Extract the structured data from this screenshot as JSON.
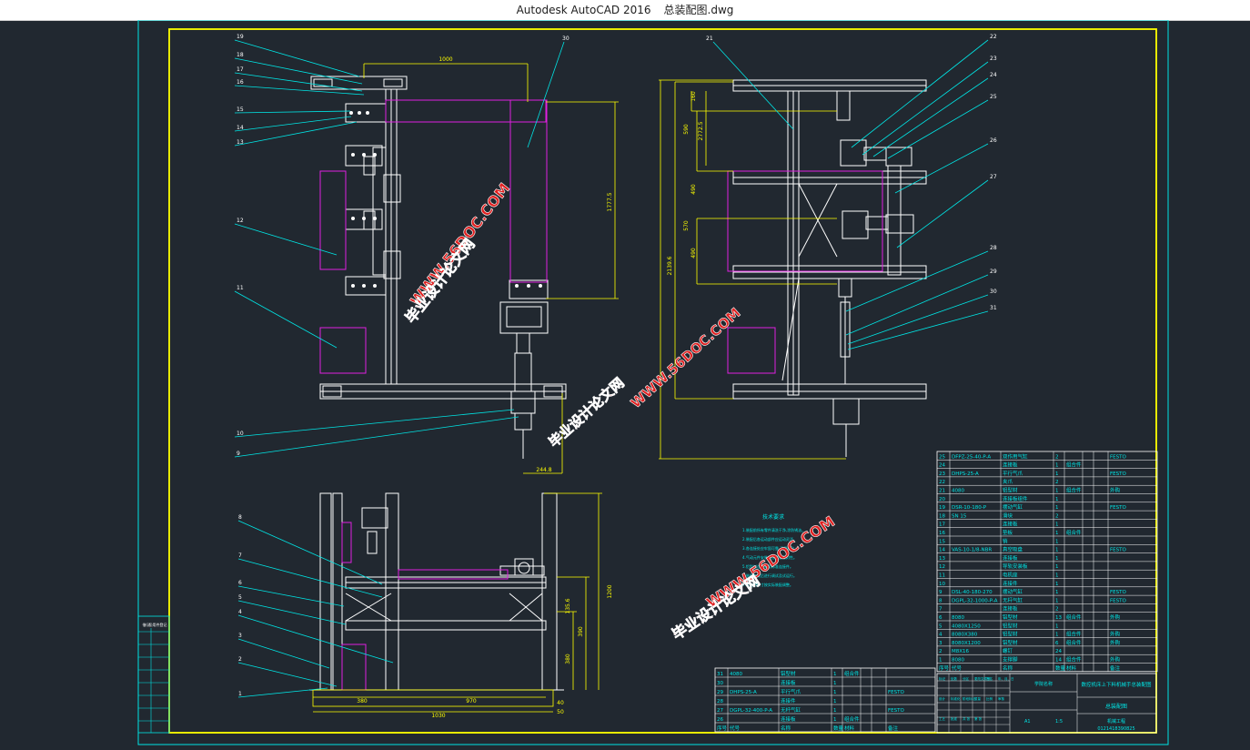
{
  "window": {
    "app_title": "Autodesk AutoCAD 2016",
    "file_name": "总装配图.dwg"
  },
  "colors": {
    "background": "#212830",
    "frame": "#ffff00",
    "leader": "#00e5e5",
    "part": "#ffffff",
    "outline": "#e020e0",
    "watermark": "#e02020"
  },
  "watermarks": [
    {
      "text": "WWW.56DOC.COM"
    },
    {
      "text": "毕业设计论文网"
    },
    {
      "text": "WWW.56DOC.COM"
    },
    {
      "text": "毕业设计论文网"
    },
    {
      "text": "WWW.56DOC.COM"
    },
    {
      "text": "毕业设计论文网"
    }
  ],
  "balloons": {
    "front_left": [
      "19",
      "18",
      "17",
      "16",
      "15",
      "14",
      "13",
      "12",
      "11",
      "10",
      "9"
    ],
    "top_center": "30",
    "side_right_top": "21",
    "side_right": [
      "22",
      "23",
      "24",
      "25",
      "26",
      "27",
      "28",
      "29",
      "30",
      "31"
    ],
    "bottom_left": [
      "8",
      "7",
      "6",
      "5",
      "4",
      "3",
      "2",
      "1"
    ]
  },
  "dimensions": {
    "front_width": "1000",
    "front_height": "1777.5",
    "front_bottom": "244.8",
    "side_total": "2139.6",
    "side_a": "160",
    "side_b": "590",
    "side_c": "2772.5",
    "side_d": "490",
    "side_e": "570",
    "side_f": "490",
    "bottom_a": "380",
    "bottom_b": "970",
    "bottom_c": "1030",
    "bottom_d": "135.6",
    "bottom_e": "390",
    "bottom_f": "380",
    "bottom_g": "1200",
    "bottom_h": "40",
    "bottom_i": "50"
  },
  "notes": {
    "title": "技术要求",
    "lines": [
      "1.装配前所有零件清洗干净,涂防锈油。",
      "2.装配后各运动部件应运动灵活。",
      "3.各连接处应牢固可靠,不得松动。",
      "4.气动元件安装前应检查密封性。",
      "5.铝型材连接采用标准连接件。",
      "6.装配完成后进行调试及试运行。",
      "7.未注明尺寸按实际装配调整。"
    ]
  },
  "left_stamp": {
    "header": "借(通)用件登记",
    "rows": [
      "",
      "",
      "",
      "",
      "",
      "",
      "",
      ""
    ]
  },
  "bom_upper": {
    "rows": [
      {
        "no": "25",
        "code": "DFPZ-25-40-P-A",
        "name": "双作用气缸",
        "qty": "2",
        "mat": "",
        "note": "FESTO"
      },
      {
        "no": "24",
        "code": "",
        "name": "连接板",
        "qty": "1",
        "mat": "组合件",
        "note": ""
      },
      {
        "no": "23",
        "code": "DHPS-25-A",
        "name": "平行气爪",
        "qty": "1",
        "mat": "",
        "note": "FESTO"
      },
      {
        "no": "22",
        "code": "",
        "name": "夹爪",
        "qty": "2",
        "mat": "",
        "note": ""
      },
      {
        "no": "21",
        "code": "4080",
        "name": "铝型材",
        "qty": "1",
        "mat": "组合件",
        "note": "外购"
      },
      {
        "no": "20",
        "code": "",
        "name": "连接板组件",
        "qty": "1",
        "mat": "",
        "note": ""
      },
      {
        "no": "19",
        "code": "DSR-10-180-P",
        "name": "摆动气缸",
        "qty": "1",
        "mat": "",
        "note": "FESTO"
      },
      {
        "no": "18",
        "code": "SN 15",
        "name": "滑块",
        "qty": "2",
        "mat": "",
        "note": ""
      },
      {
        "no": "17",
        "code": "",
        "name": "连接板",
        "qty": "1",
        "mat": "",
        "note": ""
      },
      {
        "no": "16",
        "code": "",
        "name": "垫板",
        "qty": "1",
        "mat": "组合件",
        "note": ""
      },
      {
        "no": "15",
        "code": "",
        "name": "销",
        "qty": "1",
        "mat": "",
        "note": ""
      },
      {
        "no": "14",
        "code": "VAS-10-1/8-NBR",
        "name": "真空吸盘",
        "qty": "1",
        "mat": "",
        "note": "FESTO"
      },
      {
        "no": "13",
        "code": "",
        "name": "连接板",
        "qty": "1",
        "mat": "",
        "note": ""
      },
      {
        "no": "12",
        "code": "",
        "name": "导轨安装板",
        "qty": "1",
        "mat": "",
        "note": ""
      },
      {
        "no": "11",
        "code": "",
        "name": "电机座",
        "qty": "1",
        "mat": "",
        "note": ""
      },
      {
        "no": "10",
        "code": "",
        "name": "连接件",
        "qty": "1",
        "mat": "",
        "note": ""
      },
      {
        "no": "9",
        "code": "DSL-40-180-270",
        "name": "摆动气缸",
        "qty": "1",
        "mat": "",
        "note": "FESTO"
      },
      {
        "no": "8",
        "code": "DGPL-32-1000-P-A",
        "name": "无杆气缸",
        "qty": "1",
        "mat": "",
        "note": "FESTO"
      },
      {
        "no": "7",
        "code": "",
        "name": "连接板",
        "qty": "2",
        "mat": "",
        "note": ""
      },
      {
        "no": "6",
        "code": "8080",
        "name": "铝型材",
        "qty": "13",
        "mat": "组合件",
        "note": "外购"
      },
      {
        "no": "5",
        "code": "4080X1250",
        "name": "铝型材",
        "qty": "1",
        "mat": "",
        "note": ""
      },
      {
        "no": "4",
        "code": "8080X380",
        "name": "铝型材",
        "qty": "1",
        "mat": "组合件",
        "note": "外购"
      },
      {
        "no": "3",
        "code": "8080X1200",
        "name": "铝型材",
        "qty": "6",
        "mat": "组合件",
        "note": "外购"
      },
      {
        "no": "2",
        "code": "M8X16",
        "name": "螺钉",
        "qty": "24",
        "mat": "",
        "note": ""
      },
      {
        "no": "1",
        "code": "8080",
        "name": "支撑脚",
        "qty": "14",
        "mat": "组合件",
        "note": "外购"
      }
    ],
    "header": {
      "no": "序号",
      "code": "代号",
      "name": "名称",
      "qty": "数量",
      "mat": "材料",
      "note": "备注"
    }
  },
  "bom_lower": {
    "rows": [
      {
        "no": "31",
        "code": "4080",
        "name": "铝型材",
        "qty": "1",
        "mat": "组合件",
        "note": ""
      },
      {
        "no": "30",
        "code": "",
        "name": "连接板",
        "qty": "1",
        "mat": "",
        "note": ""
      },
      {
        "no": "29",
        "code": "DHPS-25-A",
        "name": "平行气爪",
        "qty": "1",
        "mat": "",
        "note": "FESTO"
      },
      {
        "no": "28",
        "code": "",
        "name": "连接件",
        "qty": "1",
        "mat": "",
        "note": ""
      },
      {
        "no": "27",
        "code": "DGPL-32-400-P-A",
        "name": "无杆气缸",
        "qty": "1",
        "mat": "",
        "note": "FESTO"
      },
      {
        "no": "26",
        "code": "",
        "name": "连接板",
        "qty": "1",
        "mat": "组合件",
        "note": ""
      }
    ],
    "header": {
      "no": "序号",
      "code": "代号",
      "name": "名称",
      "qty": "数量",
      "mat": "材料",
      "note": "备注"
    }
  },
  "title_block": {
    "title": "数控机床上下料机械手总装配图",
    "drawing_no": "总装配图",
    "company": "机械工程",
    "scale": "1:5",
    "sheet": "A1",
    "code": "0121418390825",
    "school": "学院名称",
    "labels": [
      "标记",
      "处数",
      "分区",
      "更改文件号",
      "签名",
      "年、月、日",
      "设计",
      "标准化",
      "阶段标记",
      "重量",
      "比例",
      "审核",
      "工艺",
      "批准",
      "共 张",
      "第 张"
    ]
  }
}
